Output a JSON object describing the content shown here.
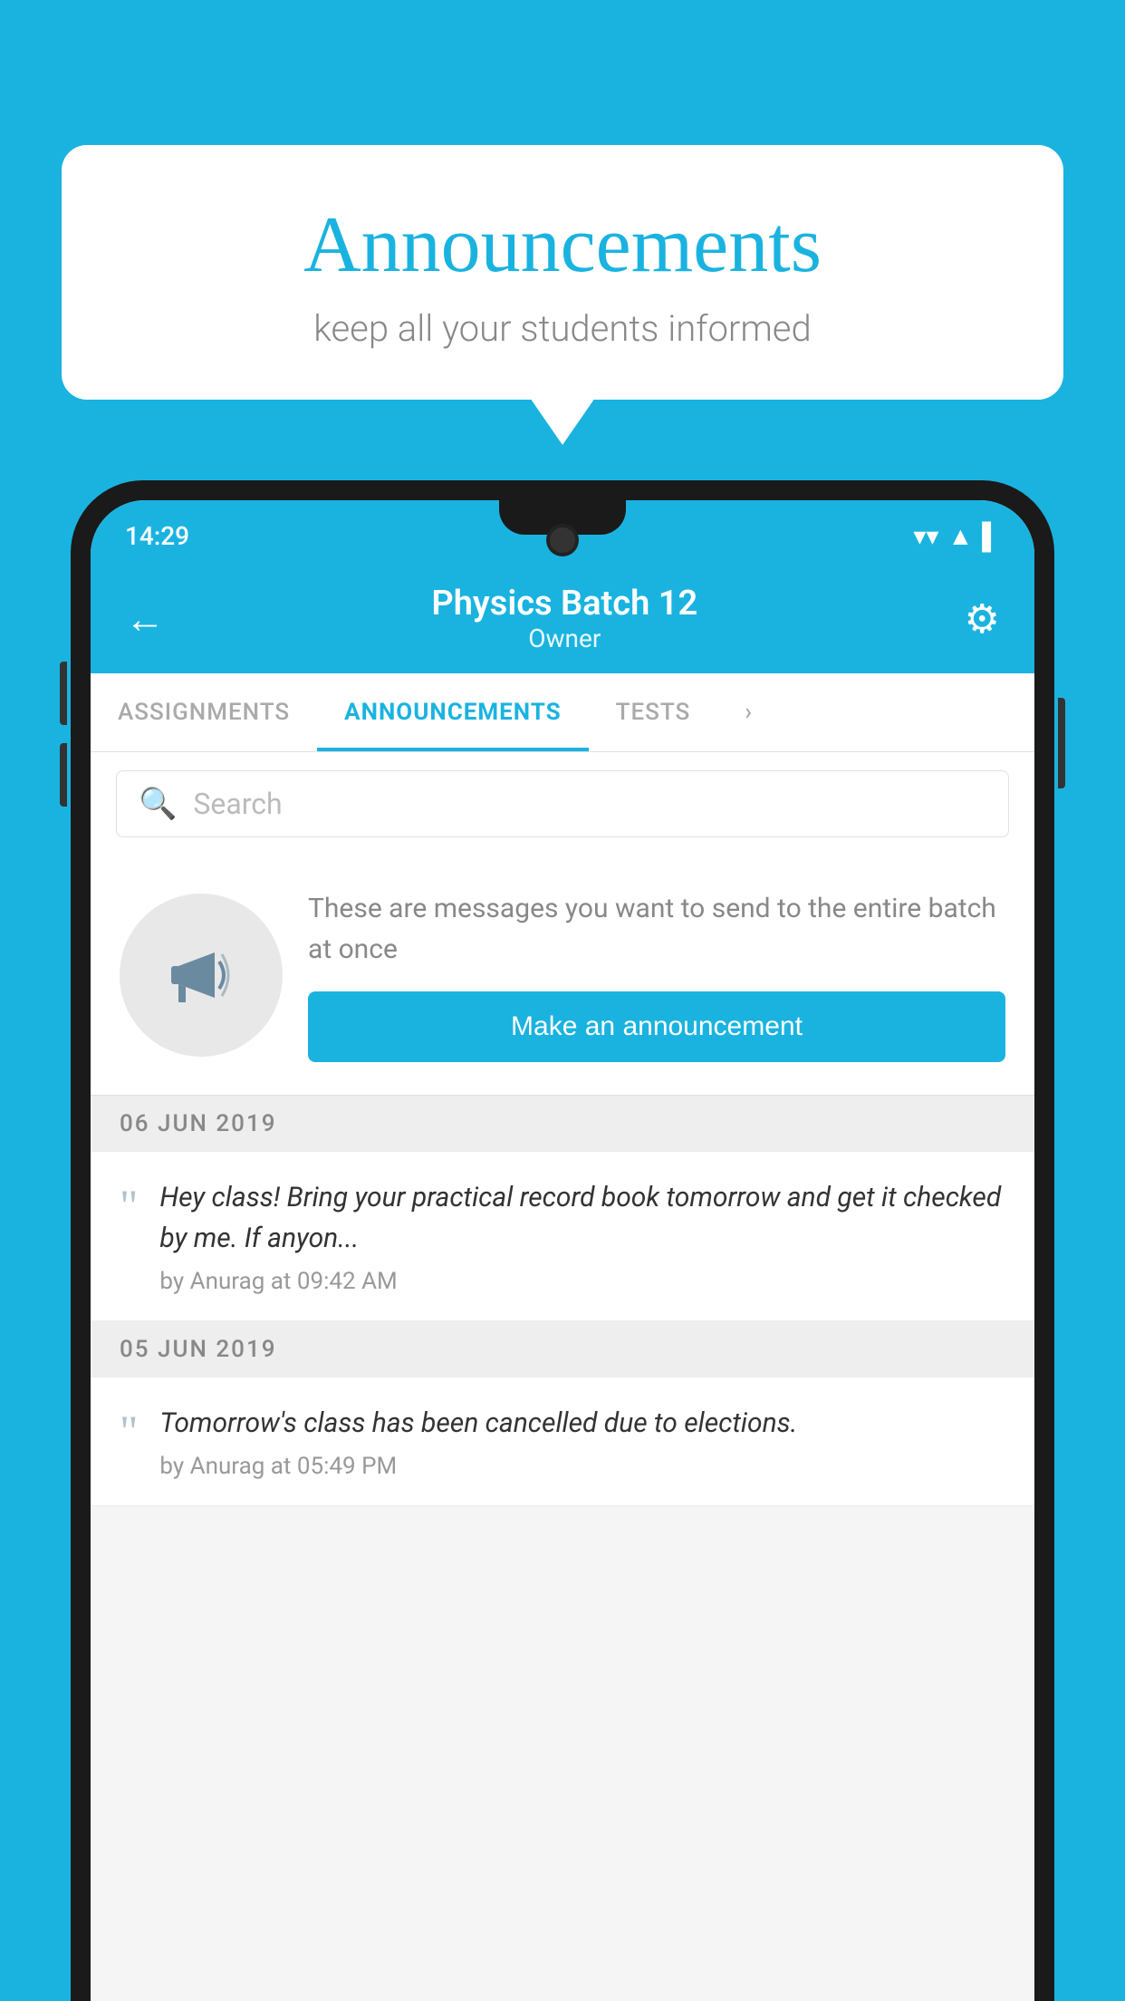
{
  "background": {
    "color": "#1ab3e0"
  },
  "speech_bubble": {
    "title": "Announcements",
    "subtitle": "keep all your students informed"
  },
  "phone": {
    "status_bar": {
      "time": "14:29",
      "wifi": "▼",
      "signal": "▲",
      "battery": "▌"
    },
    "header": {
      "title": "Physics Batch 12",
      "subtitle": "Owner",
      "back_label": "←",
      "settings_label": "⚙"
    },
    "tabs": [
      {
        "label": "ASSIGNMENTS",
        "active": false
      },
      {
        "label": "ANNOUNCEMENTS",
        "active": true
      },
      {
        "label": "TESTS",
        "active": false
      },
      {
        "label": "›",
        "active": false
      }
    ],
    "search": {
      "placeholder": "Search"
    },
    "announcement_prompt": {
      "description": "These are messages you want to send to the entire batch at once",
      "button_label": "Make an announcement"
    },
    "announcements": [
      {
        "date": "06  JUN  2019",
        "message": "Hey class! Bring your practical record book tomorrow and get it checked by me. If anyon...",
        "by": "by Anurag at 09:42 AM"
      },
      {
        "date": "05  JUN  2019",
        "message": "Tomorrow's class has been cancelled due to elections.",
        "by": "by Anurag at 05:49 PM"
      }
    ]
  }
}
